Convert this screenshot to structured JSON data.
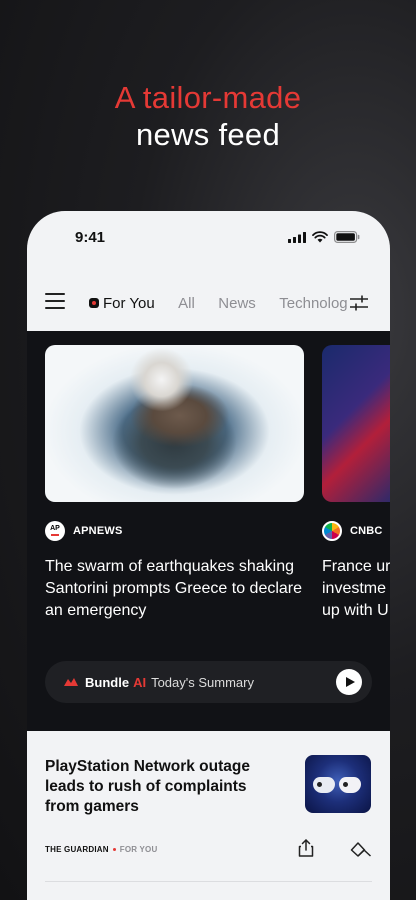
{
  "promo": {
    "line1": "A tailor-made",
    "line2": "news feed"
  },
  "status_bar": {
    "time": "9:41"
  },
  "tabs": [
    {
      "label": "For You",
      "active": true
    },
    {
      "label": "All",
      "active": false
    },
    {
      "label": "News",
      "active": false
    },
    {
      "label": "Technology",
      "active": false
    }
  ],
  "cards": [
    {
      "source": "APNEWS",
      "headline": "The swarm of earthquakes shaking Santorini prompts Greece to declare an emergency"
    },
    {
      "source": "CNBC",
      "headline": "France ur investme up with U"
    }
  ],
  "bundle_summary": {
    "brand": "Bundle",
    "ai": "AI",
    "label": "Today's Summary"
  },
  "article": {
    "title": "PlayStation Network outage leads to rush of complaints from gamers",
    "source": "THE GUARDIAN",
    "tag": "FOR YOU"
  },
  "colors": {
    "accent": "#e53935",
    "feed_bg": "#111216",
    "phone_bg": "#f2f3f5"
  },
  "icons": [
    "hamburger-menu-icon",
    "for-you-icon",
    "filter-icon",
    "signal-icon",
    "wifi-icon",
    "battery-icon",
    "play-icon",
    "share-icon",
    "bundle-icon"
  ]
}
